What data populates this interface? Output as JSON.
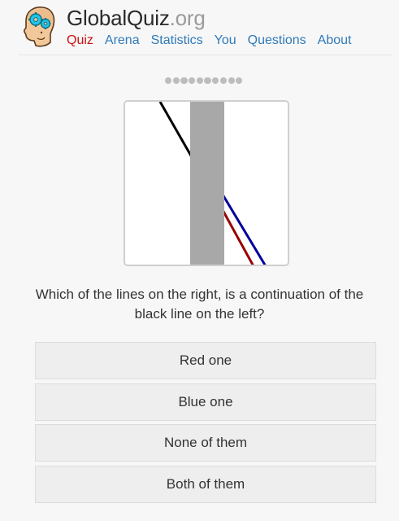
{
  "brand": {
    "name": "GlobalQuiz",
    "tld": ".org"
  },
  "nav": {
    "items": [
      {
        "label": "Quiz",
        "active": true
      },
      {
        "label": "Arena",
        "active": false
      },
      {
        "label": "Statistics",
        "active": false
      },
      {
        "label": "You",
        "active": false
      },
      {
        "label": "Questions",
        "active": false
      },
      {
        "label": "About",
        "active": false
      }
    ]
  },
  "quiz": {
    "question": "Which of the lines on the right, is a continuation of the black line on the left?",
    "progress_dots": 10,
    "answers": [
      {
        "label": "Red one"
      },
      {
        "label": "Blue one"
      },
      {
        "label": "None of them"
      },
      {
        "label": "Both of them"
      }
    ]
  },
  "colors": {
    "active_nav": "#cc1111",
    "nav_link": "#2f7ab8",
    "line_black": "#000000",
    "line_red": "#990000",
    "line_blue": "#000099",
    "occluder": "#a8a8a8"
  },
  "icons": {
    "logo": "brain-gears-head-icon"
  }
}
